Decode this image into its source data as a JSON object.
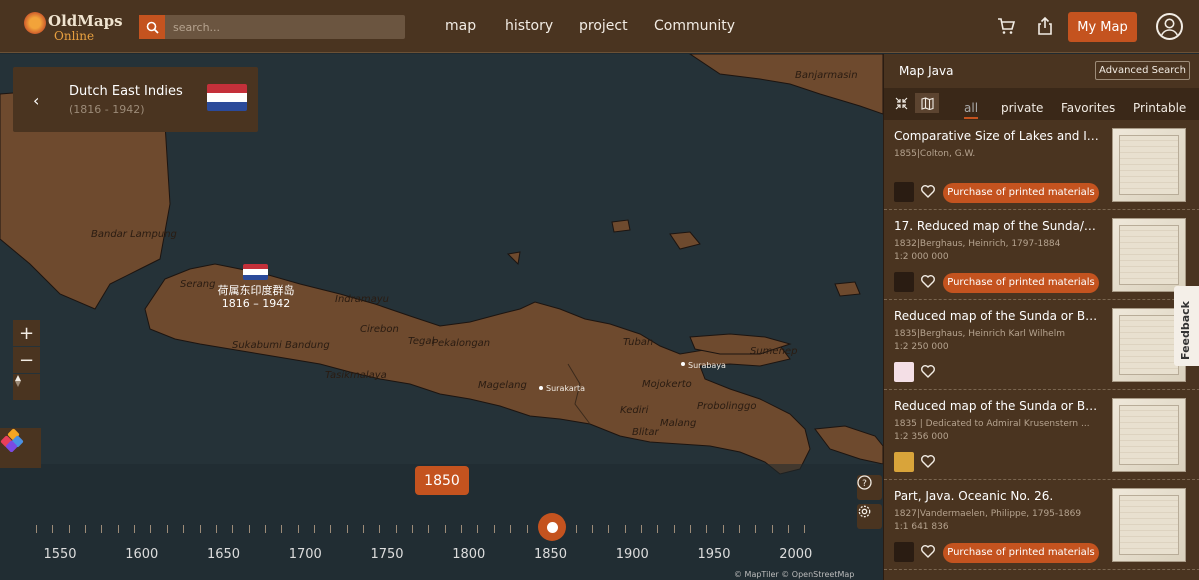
{
  "brand": {
    "line1": "OldMaps",
    "line2": "Online"
  },
  "search": {
    "placeholder": "search..."
  },
  "nav": [
    "map",
    "history",
    "project",
    "Community"
  ],
  "header": {
    "my_map": "My Map"
  },
  "country": {
    "name": "Dutch East Indies",
    "years": "(1816 - 1942)",
    "map_label_cn": "荷属东印度群岛",
    "map_label_years": "1816 – 1942"
  },
  "places": [
    "Banjarmasin",
    "Bandar Lampung",
    "Serang",
    "Indramayu",
    "Cirebon",
    "Sukabumi",
    "Bandung",
    "Tegal",
    "Pekalongan",
    "Tasikmalaya",
    "Magelang",
    "Tuban",
    "Sumenep",
    "Mojokerto",
    "Kediri",
    "Probolinggo",
    "Blitar",
    "Malang"
  ],
  "cities": [
    "Surabaya",
    "Surakarta"
  ],
  "timeline": {
    "current": "1850",
    "labels": [
      "1550",
      "1600",
      "1650",
      "1700",
      "1750",
      "1800",
      "1850",
      "1900",
      "1950",
      "2000"
    ]
  },
  "credits": "© MapTiler © OpenStreetMap",
  "panel": {
    "title": "Map Java",
    "advanced": "Advanced Search",
    "tabs": [
      "all",
      "private",
      "Favorites",
      "Printable"
    ],
    "items": [
      {
        "title": "Comparative Size of Lakes and Isla...",
        "meta": "1855|Colton, G.W.",
        "scale": "",
        "buy": "Purchase of printed materials"
      },
      {
        "title": "17. Reduced map of the Sunda/or ...",
        "meta": "1832|Berghaus, Heinrich, 1797-1884",
        "scale": "1:2 000 000",
        "buy": "Purchase of printed materials"
      },
      {
        "title": "Reduced map of the Sunda or Bor...",
        "meta": "1835|Berghaus, Heinrich Karl Wilhelm",
        "scale": "1:2 250 000",
        "buy": ""
      },
      {
        "title": "Reduced map of the Sunda or Bor...",
        "meta": "1835 | Dedicated to Admiral Krusenstern ...",
        "scale": "1:2 356 000",
        "buy": ""
      },
      {
        "title": "Part, Java. Oceanic No. 26.",
        "meta": "1827|Vandermaelen, Philippe, 1795-1869",
        "scale": "1:1 641 836",
        "buy": "Purchase of printed materials"
      }
    ]
  },
  "feedback": "Feedback",
  "colors": {
    "accent": "#c4531f",
    "land": "#6e4a2e",
    "sea": "#253238",
    "panel": "#4a3420"
  }
}
